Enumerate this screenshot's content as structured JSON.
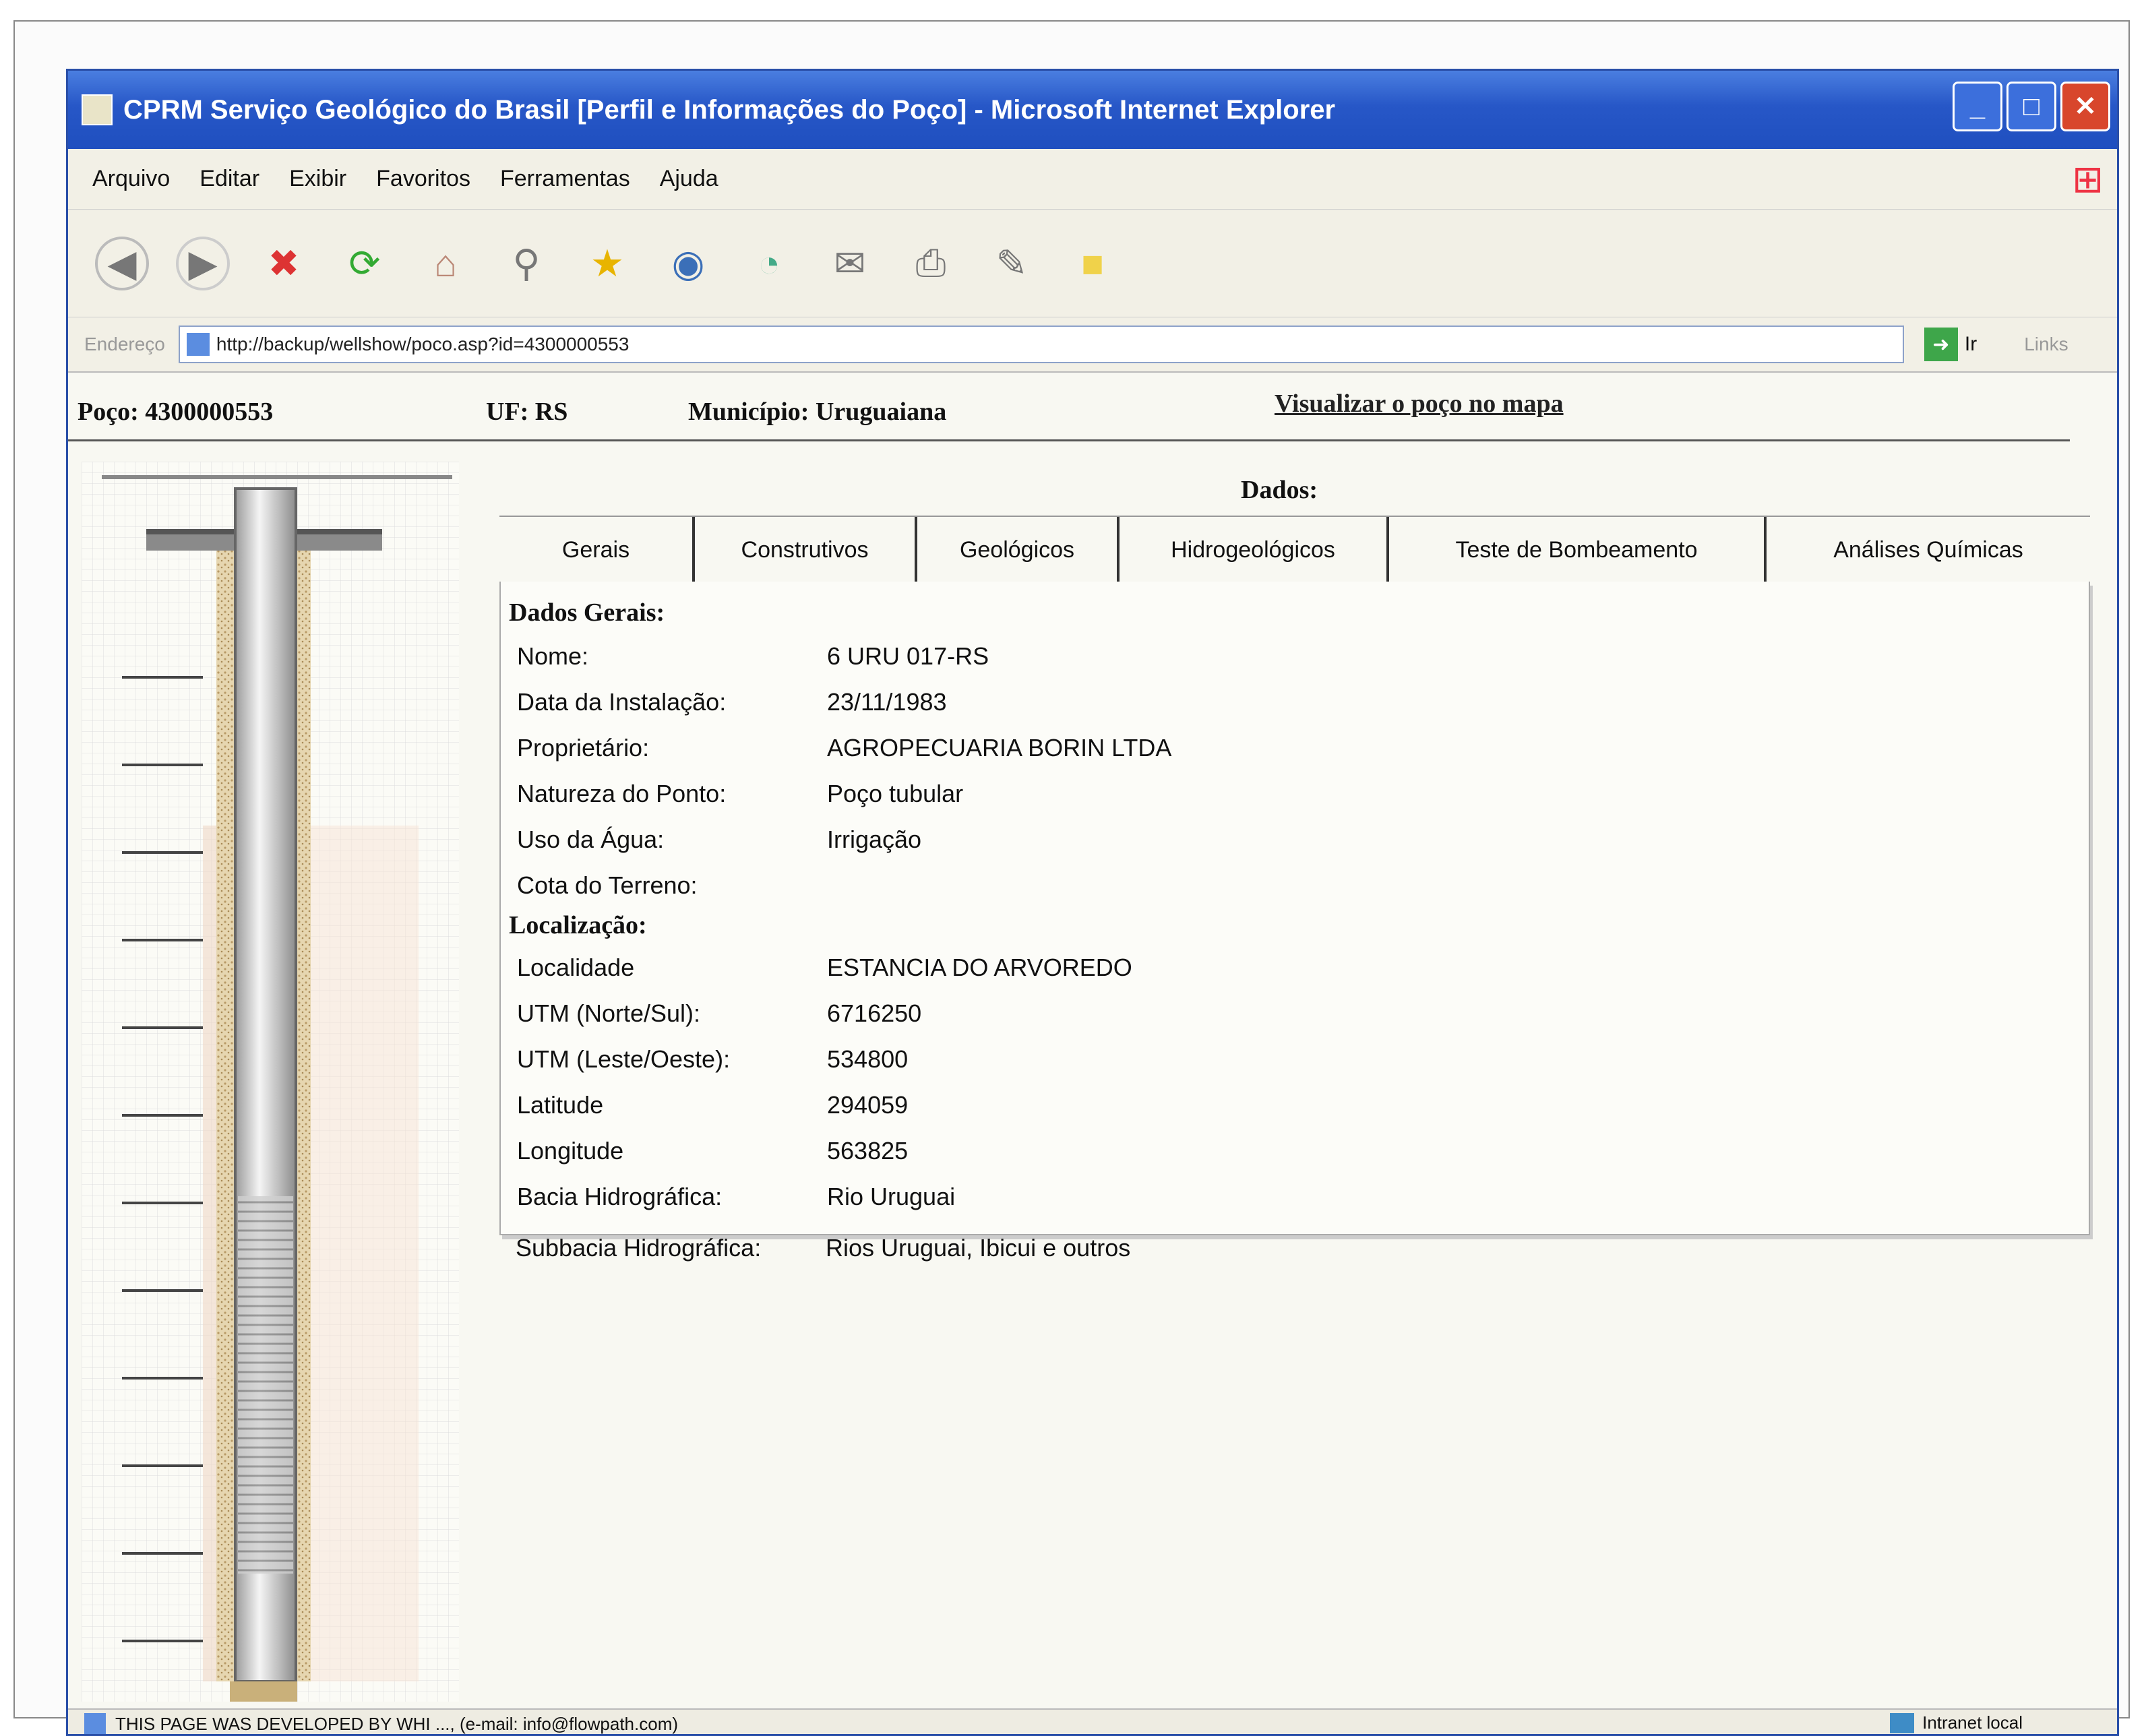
{
  "window": {
    "title": "CPRM   Serviço Geológico do Brasil [Perfil e Informações do Poço] - Microsoft Internet Explorer"
  },
  "menu": [
    "Arquivo",
    "Editar",
    "Exibir",
    "Favoritos",
    "Ferramentas",
    "Ajuda"
  ],
  "toolbar_icons": [
    "back-icon",
    "forward-icon",
    "stop-icon",
    "refresh-icon",
    "home-icon",
    "search-icon",
    "favorites-icon",
    "media-icon",
    "history-icon",
    "mail-icon",
    "print-icon",
    "edit-icon",
    "messenger-icon"
  ],
  "address": {
    "label": "Endereço",
    "url": "http://backup/wellshow/poco.asp?id=4300000553",
    "go_label": "Ir",
    "links_label": "Links"
  },
  "info": {
    "poco": "Poço: 4300000553",
    "uf": "UF: RS",
    "municipio": "Município: Uruguaiana",
    "map_link": "Visualizar o poço no mapa"
  },
  "dados_heading": "Dados:",
  "tabs": [
    "Gerais",
    "Construtivos",
    "Geológicos",
    "Hidrogeológicos",
    "Teste de Bombeamento",
    "Análises Químicas"
  ],
  "gerais": {
    "section1_title": "Dados Gerais:",
    "section1": [
      {
        "label": "Nome:",
        "value": "6 URU 017-RS"
      },
      {
        "label": "Data da Instalação:",
        "value": "23/11/1983"
      },
      {
        "label": "Proprietário:",
        "value": "AGROPECUARIA BORIN LTDA"
      },
      {
        "label": "Natureza do Ponto:",
        "value": "Poço tubular"
      },
      {
        "label": "Uso da Água:",
        "value": "Irrigação"
      },
      {
        "label": "Cota do Terreno:",
        "value": ""
      }
    ],
    "section2_title": "Localização:",
    "section2": [
      {
        "label": "Localidade",
        "value": "ESTANCIA DO ARVOREDO"
      },
      {
        "label": "UTM (Norte/Sul):",
        "value": "6716250"
      },
      {
        "label": "UTM (Leste/Oeste):",
        "value": "534800"
      },
      {
        "label": "Latitude",
        "value": "294059"
      },
      {
        "label": "Longitude",
        "value": "563825"
      },
      {
        "label": "Bacia Hidrográfica:",
        "value": "Rio Uruguai"
      },
      {
        "label": "Subbacia Hidrográfica:",
        "value": "Rios Uruguai, Ibicui e outros"
      }
    ]
  },
  "status": {
    "text": "THIS PAGE WAS DEVELOPED BY WHI ..., (e-mail: info@flowpath.com)",
    "zone": "Intranet local"
  },
  "colors": {
    "titlebar": "#2757c7",
    "close": "#d8462c",
    "sand": "#e6d6b0"
  }
}
